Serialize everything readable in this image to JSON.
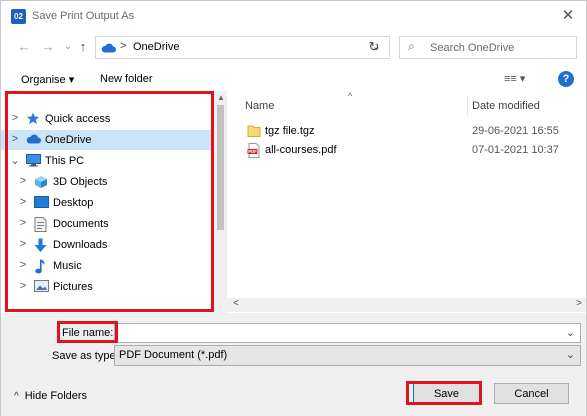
{
  "window": {
    "app_icon_text": "02",
    "title": "Save Print Output As",
    "close_glyph": "✕"
  },
  "navigation": {
    "back_glyph": "←",
    "forward_glyph": "→",
    "recent_glyph": "⌄",
    "up_glyph": "↑",
    "path_separator": ">",
    "path": "OneDrive",
    "dropdown_glyph": "⌄",
    "refresh_glyph": "↻"
  },
  "search": {
    "glyph": "⌕",
    "placeholder": "Search OneDrive"
  },
  "toolbar": {
    "organise_label": "Organise ▾",
    "new_folder_label": "New folder",
    "view_glyph": "≡≡ ▾",
    "help_glyph": "?"
  },
  "sidebar": {
    "items": [
      {
        "label": "Quick access",
        "icon": "star-icon",
        "level": 0,
        "chevron": ">"
      },
      {
        "label": "OneDrive",
        "icon": "cloud-icon",
        "level": 0,
        "chevron": ">",
        "selected": true
      },
      {
        "label": "This PC",
        "icon": "computer-icon",
        "level": 0,
        "chevron": "⌄"
      },
      {
        "label": "3D Objects",
        "icon": "cube-icon",
        "level": 1,
        "chevron": ">"
      },
      {
        "label": "Desktop",
        "icon": "desktop-icon",
        "level": 1,
        "chevron": ">"
      },
      {
        "label": "Documents",
        "icon": "document-icon",
        "level": 1,
        "chevron": ">"
      },
      {
        "label": "Downloads",
        "icon": "download-icon",
        "level": 1,
        "chevron": ">"
      },
      {
        "label": "Music",
        "icon": "music-icon",
        "level": 1,
        "chevron": ">"
      },
      {
        "label": "Pictures",
        "icon": "picture-icon",
        "level": 1,
        "chevron": ">"
      }
    ],
    "scroll_up_glyph": "▲"
  },
  "file_list": {
    "sort_glyph": "^",
    "columns": {
      "name": "Name",
      "date": "Date modified"
    },
    "files": [
      {
        "name": "tgz file.tgz",
        "date": "29-06-2021 16:55",
        "icon": "folder-file-icon"
      },
      {
        "name": "all-courses.pdf",
        "date": "07-01-2021 10:37",
        "icon": "pdf-file-icon"
      }
    ],
    "scroll_left_glyph": "<",
    "scroll_right_glyph": ">"
  },
  "form": {
    "file_name_label": "File name:",
    "file_name_value": "",
    "file_name_drop_glyph": "⌄",
    "save_as_type_label": "Save as type:",
    "save_as_type_value": "PDF Document (*.pdf)",
    "save_as_type_drop_glyph": "⌄"
  },
  "footer": {
    "hide_folders_glyph": "^",
    "hide_folders_label": "Hide Folders",
    "save_label": "Save",
    "cancel_label": "Cancel"
  },
  "colors": {
    "highlight": "#e0141e",
    "selection": "#cce4f7",
    "accent": "#0078d7"
  }
}
